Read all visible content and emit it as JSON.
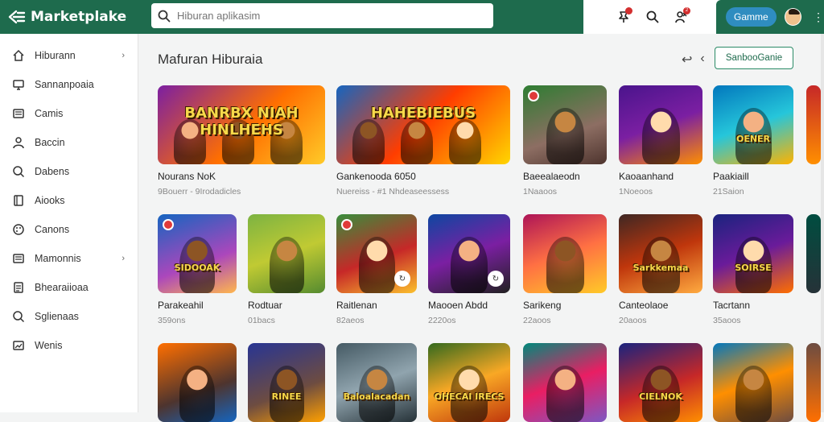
{
  "app": {
    "name": "Marketplake",
    "accent": "#1e6b4d"
  },
  "search": {
    "placeholder": "Hiburan aplikasim"
  },
  "user": {
    "game_button": "Gamme",
    "notification_count": "2"
  },
  "sidebar": {
    "items": [
      {
        "label": "Hiburann",
        "icon": "home-icon",
        "chevron": true
      },
      {
        "label": "Sannanpoaia",
        "icon": "monitor-icon",
        "chevron": false
      },
      {
        "label": "Camis",
        "icon": "list-icon",
        "chevron": false
      },
      {
        "label": "Baccin",
        "icon": "user-icon",
        "chevron": false
      },
      {
        "label": "Dabens",
        "icon": "search-icon",
        "chevron": false
      },
      {
        "label": "Aiooks",
        "icon": "book-icon",
        "chevron": false
      },
      {
        "label": "Canons",
        "icon": "palette-icon",
        "chevron": false
      },
      {
        "label": "Mamonnis",
        "icon": "list-icon",
        "chevron": true
      },
      {
        "label": "Bhearaiioaa",
        "icon": "document-icon",
        "chevron": false
      },
      {
        "label": "Sglienaas",
        "icon": "search-icon",
        "chevron": false
      },
      {
        "label": "Wenis",
        "icon": "image-icon",
        "chevron": false
      }
    ]
  },
  "main": {
    "title": "Mafuran Hiburaia",
    "solo_button": "SanbooGanie",
    "cards": [
      {
        "title": "Nourans NoK",
        "meta": "9Bouerr - 9Irodadicles",
        "art": "BANRBX NIAH HINLHEHS"
      },
      {
        "title": "Gankenooda 6050",
        "meta": "Nuereiss - #1 Nhdeaseessess",
        "art": "HAHEBIEBUS"
      },
      {
        "title": "Baeealaeodn",
        "meta": "1Naaoos",
        "art": ""
      },
      {
        "title": "Kaoaanhand",
        "meta": "1Noeoos",
        "art": ""
      },
      {
        "title": "Paakiaill",
        "meta": "21Saion",
        "art": "OENER"
      },
      {
        "title": "Parakeahil",
        "meta": "359ons",
        "art": "SIDOOAK"
      },
      {
        "title": "Rodtuar",
        "meta": "01bacs",
        "art": ""
      },
      {
        "title": "Raitlenan",
        "meta": "82aeos",
        "art": ""
      },
      {
        "title": "Maooen Abdd",
        "meta": "2220os",
        "art": ""
      },
      {
        "title": "Sarikeng",
        "meta": "22aoos",
        "art": ""
      },
      {
        "title": "Canteolaoe",
        "meta": "20aoos",
        "art": "Sarkkemaa"
      },
      {
        "title": "Tacrtann",
        "meta": "35aoos",
        "art": "SOIRSE"
      },
      {
        "title": "",
        "meta": "",
        "art": ""
      },
      {
        "title": "",
        "meta": "",
        "art": "RINEE"
      },
      {
        "title": "",
        "meta": "",
        "art": "Baloalacadan"
      },
      {
        "title": "",
        "meta": "",
        "art": "OHECAI IRECS"
      },
      {
        "title": "",
        "meta": "",
        "art": ""
      },
      {
        "title": "",
        "meta": "",
        "art": "CIELNOK"
      },
      {
        "title": "",
        "meta": "",
        "art": ""
      }
    ]
  }
}
